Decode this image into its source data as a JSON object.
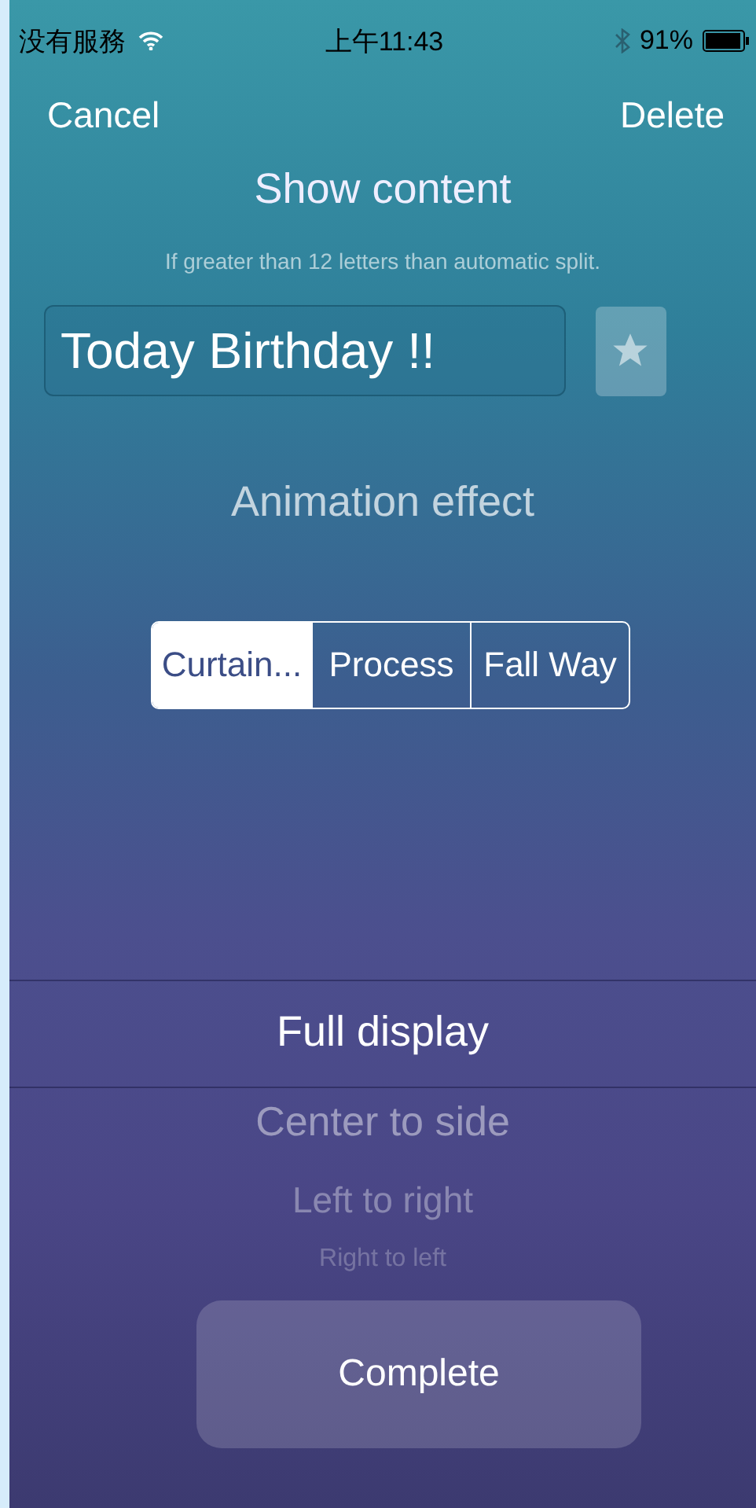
{
  "status_bar": {
    "carrier": "没有服務",
    "time": "上午11:43",
    "battery_text": "91%"
  },
  "nav": {
    "cancel": "Cancel",
    "delete": "Delete"
  },
  "content": {
    "title": "Show content",
    "hint": "If greater than 12 letters than automatic split.",
    "value": "Today Birthday !!",
    "starred": false
  },
  "animation": {
    "title": "Animation effect",
    "segments": [
      {
        "label": "Curtain...",
        "selected": true
      },
      {
        "label": "Process",
        "selected": false
      },
      {
        "label": "Fall Way",
        "selected": false
      }
    ]
  },
  "picker": {
    "items": [
      {
        "label": "Full display",
        "selected": true
      },
      {
        "label": "Center to side",
        "selected": false
      },
      {
        "label": "Left to right",
        "selected": false
      },
      {
        "label": "Right to left",
        "selected": false
      }
    ]
  },
  "complete_button": "Complete"
}
